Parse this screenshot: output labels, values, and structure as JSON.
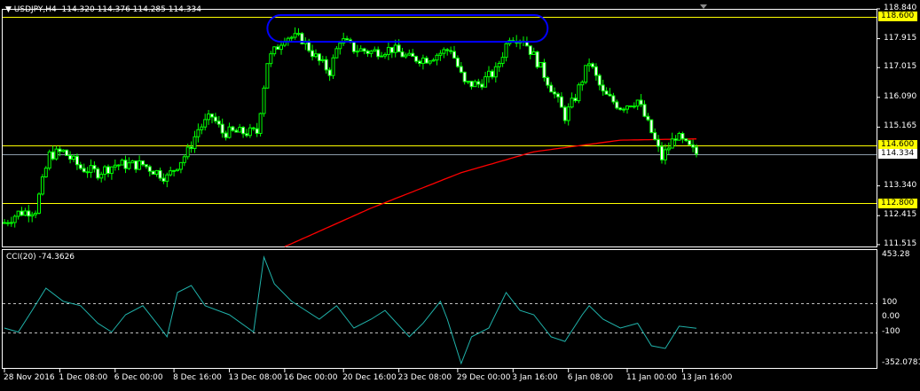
{
  "header": {
    "symbol": "USDJPY,H4",
    "ohlc": "114.320 114.376 114.285 114.334"
  },
  "cci_label": "CCI(20) -74.3626",
  "colors": {
    "candle": "#00ff00",
    "ma": "#ff0000",
    "level": "#ffff00",
    "bid": "#8c9ba8",
    "cci": "#20b2aa",
    "annotation": "#0000ff"
  },
  "chart_data": [
    {
      "type": "candlestick",
      "title": "USDJPY,H4",
      "ylim": [
        111.515,
        118.84
      ],
      "y_ticks": [
        "118.840",
        "117.915",
        "117.015",
        "116.090",
        "115.165",
        "113.340",
        "112.415",
        "111.515"
      ],
      "price_labels": [
        {
          "value": 118.6,
          "text": "118.600",
          "kind": "level"
        },
        {
          "value": 114.6,
          "text": "114.600",
          "kind": "level"
        },
        {
          "value": 114.334,
          "text": "114.334",
          "kind": "bid"
        },
        {
          "value": 112.8,
          "text": "112.800",
          "kind": "level"
        }
      ],
      "x_ticks": [
        {
          "bar": 0,
          "text": "28 Nov 2016"
        },
        {
          "bar": 16,
          "text": "1 Dec 08:00"
        },
        {
          "bar": 32,
          "text": "6 Dec 00:00"
        },
        {
          "bar": 49,
          "text": "8 Dec 16:00"
        },
        {
          "bar": 65,
          "text": "13 Dec 08:00"
        },
        {
          "bar": 81,
          "text": "16 Dec 00:00"
        },
        {
          "bar": 98,
          "text": "20 Dec 16:00"
        },
        {
          "bar": 114,
          "text": "23 Dec 08:00"
        },
        {
          "bar": 131,
          "text": "29 Dec 00:00"
        },
        {
          "bar": 147,
          "text": "3 Jan 16:00"
        },
        {
          "bar": 163,
          "text": "6 Jan 08:00"
        },
        {
          "bar": 180,
          "text": "11 Jan 00:00"
        },
        {
          "bar": 196,
          "text": "13 Jan 16:00"
        }
      ],
      "close_path": [
        [
          0,
          112.2
        ],
        [
          4,
          112.5
        ],
        [
          9,
          112.6
        ],
        [
          13,
          114.3
        ],
        [
          17,
          114.4
        ],
        [
          22,
          113.9
        ],
        [
          27,
          113.75
        ],
        [
          32,
          114.0
        ],
        [
          40,
          114.0
        ],
        [
          47,
          113.6
        ],
        [
          53,
          114.4
        ],
        [
          56,
          115.1
        ],
        [
          60,
          115.5
        ],
        [
          63,
          115.0
        ],
        [
          73,
          115.0
        ],
        [
          76,
          117.2
        ],
        [
          81,
          118.0
        ],
        [
          86,
          117.9
        ],
        [
          91,
          117.2
        ],
        [
          94,
          116.9
        ],
        [
          97,
          117.9
        ],
        [
          101,
          117.6
        ],
        [
          106,
          117.5
        ],
        [
          112,
          117.6
        ],
        [
          117,
          117.3
        ],
        [
          122,
          117.3
        ],
        [
          129,
          117.6
        ],
        [
          133,
          116.5
        ],
        [
          137,
          116.5
        ],
        [
          142,
          116.9
        ],
        [
          146,
          118.0
        ],
        [
          150,
          117.9
        ],
        [
          154,
          117.2
        ],
        [
          158,
          116.4
        ],
        [
          162,
          115.5
        ],
        [
          165,
          116.1
        ],
        [
          169,
          117.2
        ],
        [
          173,
          116.2
        ],
        [
          178,
          115.8
        ],
        [
          183,
          116.0
        ],
        [
          187,
          115.0
        ],
        [
          190,
          114.2
        ],
        [
          194,
          114.9
        ],
        [
          197,
          114.6
        ],
        [
          200,
          114.334
        ]
      ],
      "moving_average": [
        [
          81,
          111.45
        ],
        [
          106,
          112.65
        ],
        [
          132,
          113.75
        ],
        [
          153,
          114.4
        ],
        [
          178,
          114.76
        ],
        [
          200,
          114.8
        ]
      ],
      "annotation": {
        "type": "ellipse",
        "from_bar": 76,
        "to_bar": 157,
        "price_top": 118.84,
        "price_bottom": 117.9
      }
    },
    {
      "type": "line",
      "title": "CCI(20) -74.3626",
      "ylim": [
        -352.0781,
        453.28
      ],
      "y_ticks": [
        "453.28",
        "100",
        "0.00",
        "-100",
        "-352.0781"
      ],
      "levels": [
        100,
        -100
      ],
      "series": [
        {
          "name": "CCI(20)",
          "points": [
            [
              0,
              -73
            ],
            [
              4,
              -100
            ],
            [
              8,
              48
            ],
            [
              12,
              200
            ],
            [
              17,
              110
            ],
            [
              22,
              80
            ],
            [
              27,
              -40
            ],
            [
              31,
              -100
            ],
            [
              35,
              18
            ],
            [
              40,
              80
            ],
            [
              44,
              -40
            ],
            [
              47,
              -133
            ],
            [
              50,
              170
            ],
            [
              54,
              218
            ],
            [
              58,
              80
            ],
            [
              65,
              18
            ],
            [
              72,
              -100
            ],
            [
              75,
              412
            ],
            [
              78,
              230
            ],
            [
              83,
              110
            ],
            [
              91,
              -12
            ],
            [
              96,
              80
            ],
            [
              101,
              -73
            ],
            [
              106,
              -12
            ],
            [
              110,
              48
            ],
            [
              117,
              -133
            ],
            [
              121,
              -40
            ],
            [
              126,
              110
            ],
            [
              128,
              -12
            ],
            [
              132,
              -315
            ],
            [
              135,
              -133
            ],
            [
              140,
              -73
            ],
            [
              145,
              170
            ],
            [
              149,
              48
            ],
            [
              153,
              18
            ],
            [
              158,
              -133
            ],
            [
              162,
              -164
            ],
            [
              167,
              18
            ],
            [
              169,
              80
            ],
            [
              173,
              -12
            ],
            [
              178,
              -73
            ],
            [
              183,
              -40
            ],
            [
              187,
              -194
            ],
            [
              191,
              -212
            ],
            [
              195,
              -60
            ],
            [
              200,
              -74
            ]
          ]
        }
      ]
    }
  ]
}
